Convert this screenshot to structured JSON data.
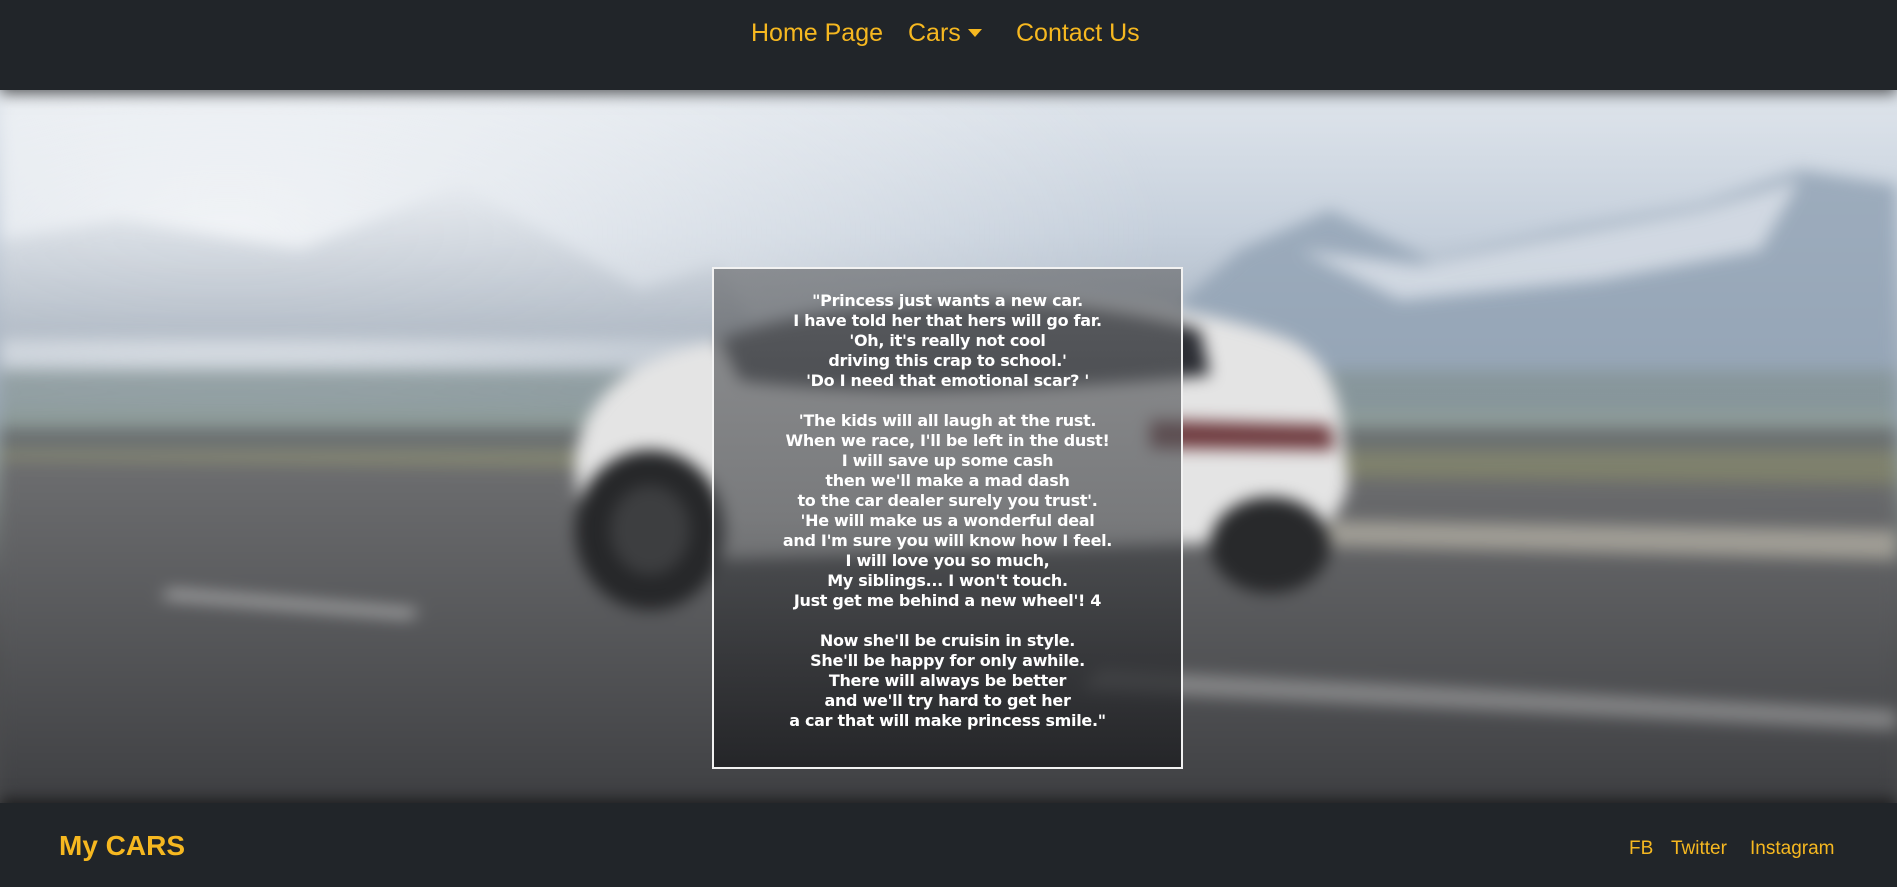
{
  "nav": {
    "home_label": "Home Page",
    "cars_label": "Cars",
    "contact_label": "Contact Us"
  },
  "poem": {
    "text": "\"Princess just wants a new car.\nI have told her that hers will go far.\n'Oh, it's really not cool\ndriving this crap to school.'\n'Do I need that emotional scar? '\n\n'The kids will all laugh at the rust.\nWhen we race, I'll be left in the dust!\nI will save up some cash\nthen we'll make a mad dash\nto the car dealer surely you trust'.\n'He will make us a wonderful deal\nand I'm sure you will know how I feel.\nI will love you so much,\nMy siblings... I won't touch.\nJust get me behind a new wheel'! 4\n\nNow she'll be cruisin in style.\nShe'll be happy for only awhile.\nThere will always be better\nand we'll try hard to get her\na car that will make princess smile.\""
  },
  "footer": {
    "brand": "My CARS",
    "links": [
      "FB",
      "Twitter",
      "Instagram"
    ]
  },
  "colors": {
    "accent": "#f6b820",
    "navbar_bg": "#212529"
  },
  "icons": {
    "cars_dropdown": "caret-down-icon"
  }
}
